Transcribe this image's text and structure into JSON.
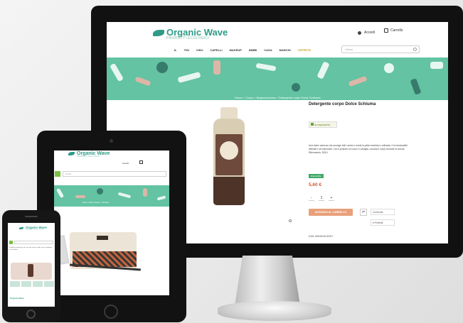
{
  "brand": {
    "logo_text": "Organic Wave",
    "logo_subtext": "PRODOTTI ECOLOGICI"
  },
  "desktop": {
    "header": {
      "account": "Accedi",
      "cart": "Carrello"
    },
    "nav": [
      "IL",
      "TISI",
      "VISO",
      "CAPELLI",
      "MAKEUP",
      "BIMBI",
      "CASA",
      "MARCHI",
      "OFFERTE"
    ],
    "search_placeholder": "Cerca",
    "breadcrumb": "Home > Corpo > Bagnoschiuma > Detergente corpo Dolce Schiuma",
    "product": {
      "title": "Detergente corpo Dolce Schiuma",
      "brand_name": "la saponaria",
      "description": "Una dolce carezza che avvolge tutti i sensi e rende la pelle morbida e vellutata. Con tensioattivi delicati e oli essenziali. Con il profumo di cocco e vaniglia, coccola il corpo durante la doccia.",
      "reference": "Riferimento: DS01",
      "stock": "Disponibile",
      "price": "5,60 €",
      "qty_minus": "-",
      "qty_value": "1",
      "qty_plus": "+",
      "add_to_cart": "AGGIUNGI AL CARRELLO",
      "compare": "Confronta",
      "wishlist": "Preferiti",
      "ean": "EAN: 8054633130027"
    }
  },
  "tablet": {
    "account": "Accedi",
    "search_placeholder": "Cerca",
    "breadcrumb": "Home > Borse beauty > Pochette"
  },
  "phone": {
    "text": "Prodotti ecologici per la cura del corpo e della casa, spedizioni in tutta Italia."
  },
  "colors": {
    "brand_green": "#2e9b86",
    "banner": "#63c3a2",
    "price": "#d25b2f",
    "cta": "#e8a07a"
  }
}
